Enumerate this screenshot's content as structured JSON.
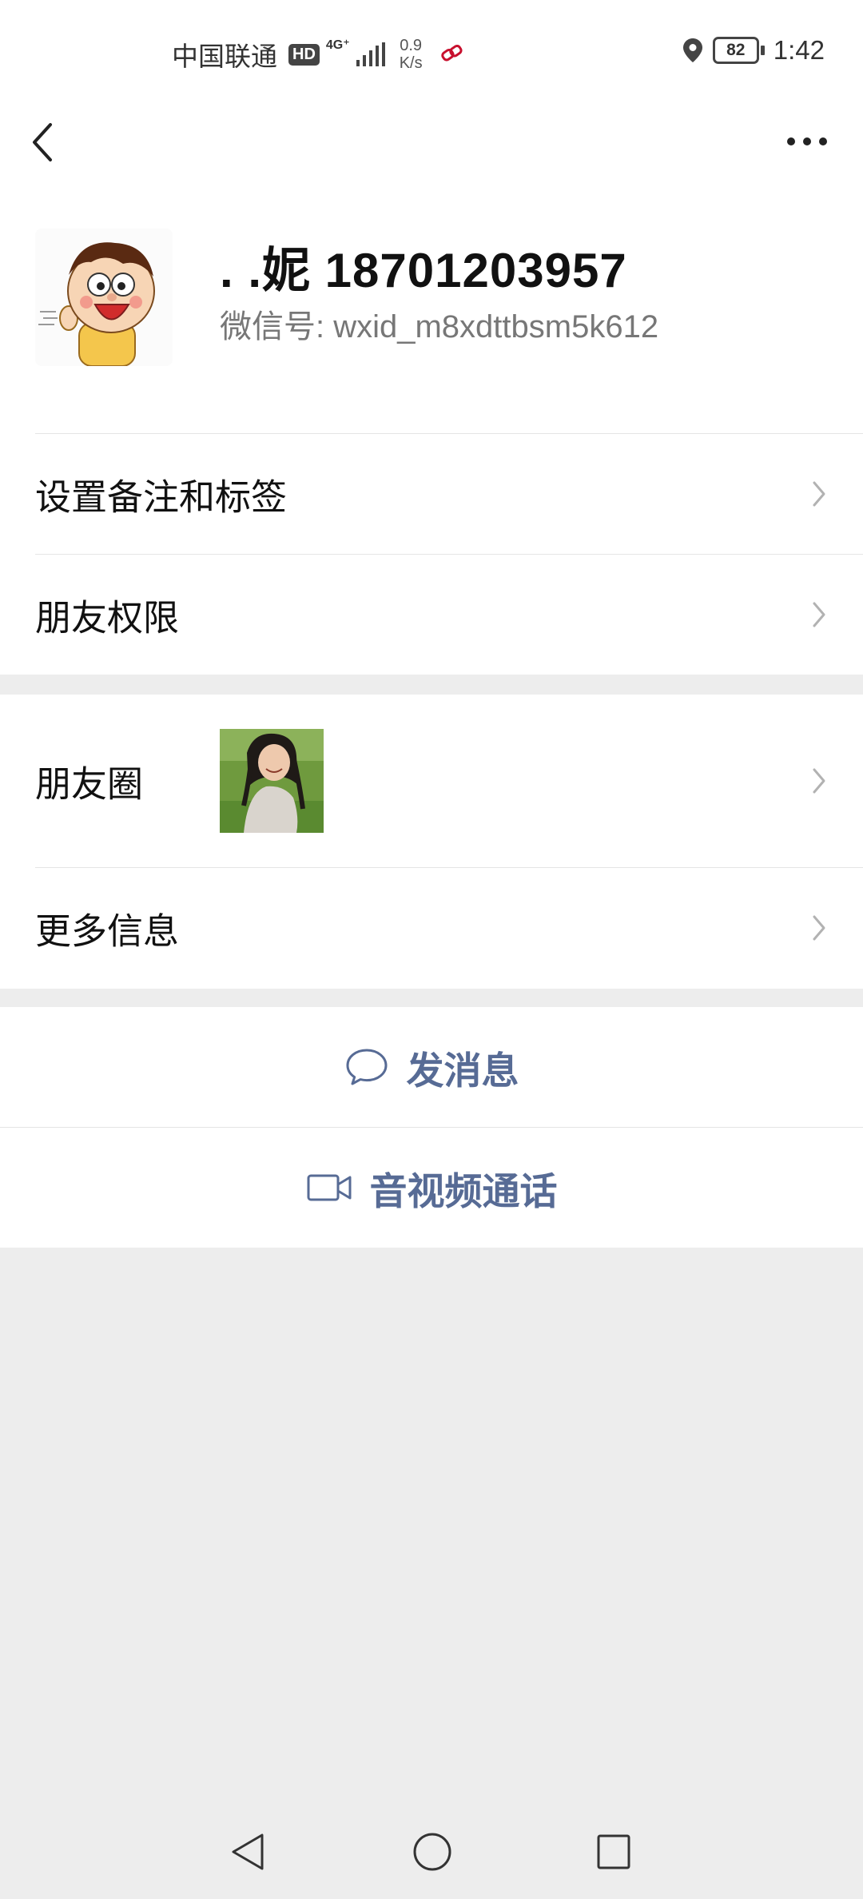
{
  "status_bar": {
    "carrier": "中国联通",
    "hd_badge": "HD",
    "network": "4G⁺",
    "speed_value": "0.9",
    "speed_unit": "K/s",
    "battery": "82",
    "time": "1:42"
  },
  "header": {
    "back_icon": "chevron-left-icon",
    "more_icon": "more-dots-icon"
  },
  "profile": {
    "name": ". .妮 18701203957",
    "wechat_id": "微信号:  wxid_m8xdttbsm5k612"
  },
  "menu": {
    "set_remark": "设置备注和标签",
    "friend_permissions": "朋友权限",
    "moments": "朋友圈",
    "more_info": "更多信息"
  },
  "actions": {
    "send_message": "发消息",
    "video_call": "音视频通话"
  },
  "colors": {
    "link_blue": "#576b95",
    "background": "#ededed"
  }
}
